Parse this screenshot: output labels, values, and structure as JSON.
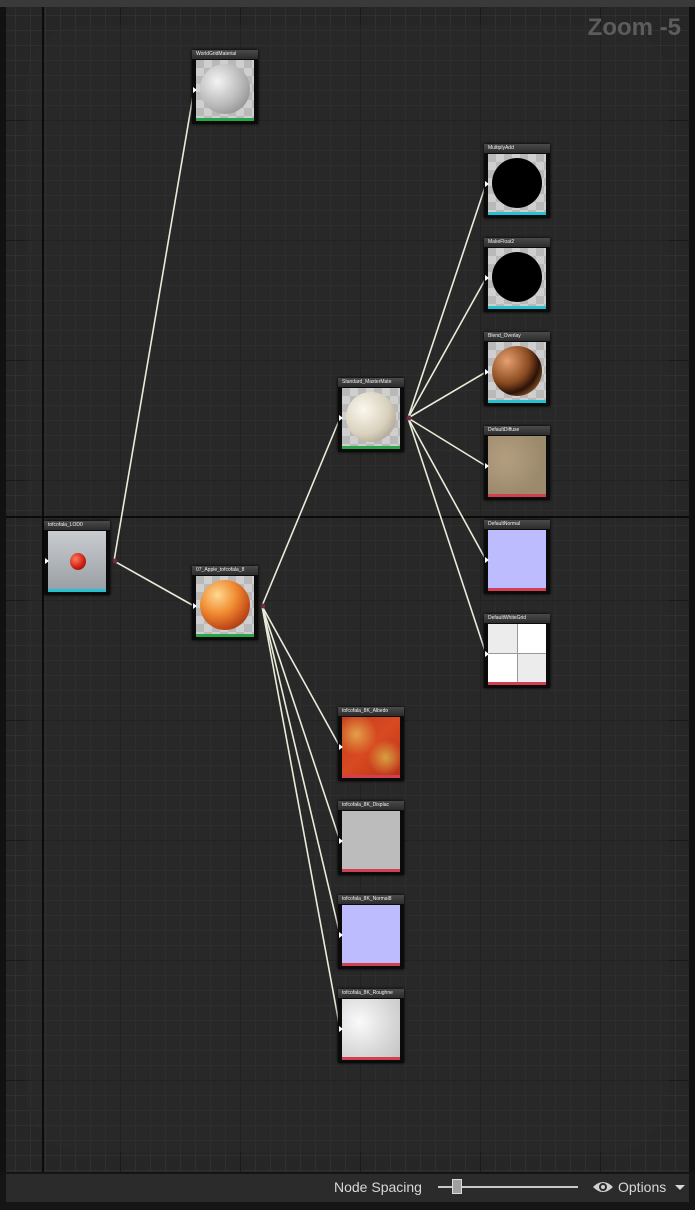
{
  "graph": {
    "zoom_label": "Zoom -5",
    "nodes": [
      {
        "id": "lod0",
        "title": "tofcofala_LOD0",
        "kind": "mesh",
        "bar_color": "#27c0d0"
      },
      {
        "id": "worldgrid",
        "title": "WorldGridMaterial",
        "kind": "material-grey",
        "bar_color": "#2aa64a"
      },
      {
        "id": "apple",
        "title": "07_Apple_tofcofala_8",
        "kind": "material-apple",
        "bar_color": "#2aa64a"
      },
      {
        "id": "mastermat",
        "title": "Standard_MasterMate",
        "kind": "material-ivory",
        "bar_color": "#2aa64a"
      },
      {
        "id": "multiplyadd",
        "title": "MultiplyAdd",
        "kind": "function-black",
        "bar_color": "#27c0d0"
      },
      {
        "id": "makefloat2",
        "title": "MakeFloat2",
        "kind": "function-black",
        "bar_color": "#27c0d0"
      },
      {
        "id": "blendoverlay",
        "title": "Blend_Overlay",
        "kind": "function-bronze",
        "bar_color": "#27c0d0"
      },
      {
        "id": "defaultdiffuse",
        "title": "DefaultDiffuse",
        "kind": "texture-sand",
        "bar_color": "#d04050"
      },
      {
        "id": "defaultnormal",
        "title": "DefaultNormal",
        "kind": "texture-normal",
        "bar_color": "#d04050"
      },
      {
        "id": "defaultwhitegrid",
        "title": "DefaultWhiteGrid",
        "kind": "texture-whitegrid",
        "bar_color": "#d04050"
      },
      {
        "id": "albedo",
        "title": "tofcofala_8K_Albedo",
        "kind": "texture-apple",
        "bar_color": "#d04050"
      },
      {
        "id": "displacement",
        "title": "tofcofala_8K_Displac",
        "kind": "texture-grey",
        "bar_color": "#d04050"
      },
      {
        "id": "normal",
        "title": "tofcofala_8K_Normal8",
        "kind": "texture-normal",
        "bar_color": "#d04050"
      },
      {
        "id": "roughness",
        "title": "tofcofala_8K_Roughne",
        "kind": "texture-cloud",
        "bar_color": "#d04050"
      }
    ],
    "edges": [
      [
        "lod0",
        "worldgrid"
      ],
      [
        "lod0",
        "apple"
      ],
      [
        "apple",
        "mastermat"
      ],
      [
        "apple",
        "albedo"
      ],
      [
        "apple",
        "displacement"
      ],
      [
        "apple",
        "normal"
      ],
      [
        "apple",
        "roughness"
      ],
      [
        "mastermat",
        "multiplyadd"
      ],
      [
        "mastermat",
        "makefloat2"
      ],
      [
        "mastermat",
        "blendoverlay"
      ],
      [
        "mastermat",
        "defaultdiffuse"
      ],
      [
        "mastermat",
        "defaultnormal"
      ],
      [
        "mastermat",
        "defaultwhitegrid"
      ]
    ]
  },
  "footer": {
    "node_spacing_label": "Node Spacing",
    "node_spacing_value": 0.1,
    "options_label": "Options",
    "options_icon": "eye-icon"
  },
  "colors": {
    "wire": "#e8ecd8",
    "canvas": "#262626",
    "accent_texture": "#d04050",
    "accent_material": "#2aa64a",
    "accent_function": "#27c0d0"
  }
}
